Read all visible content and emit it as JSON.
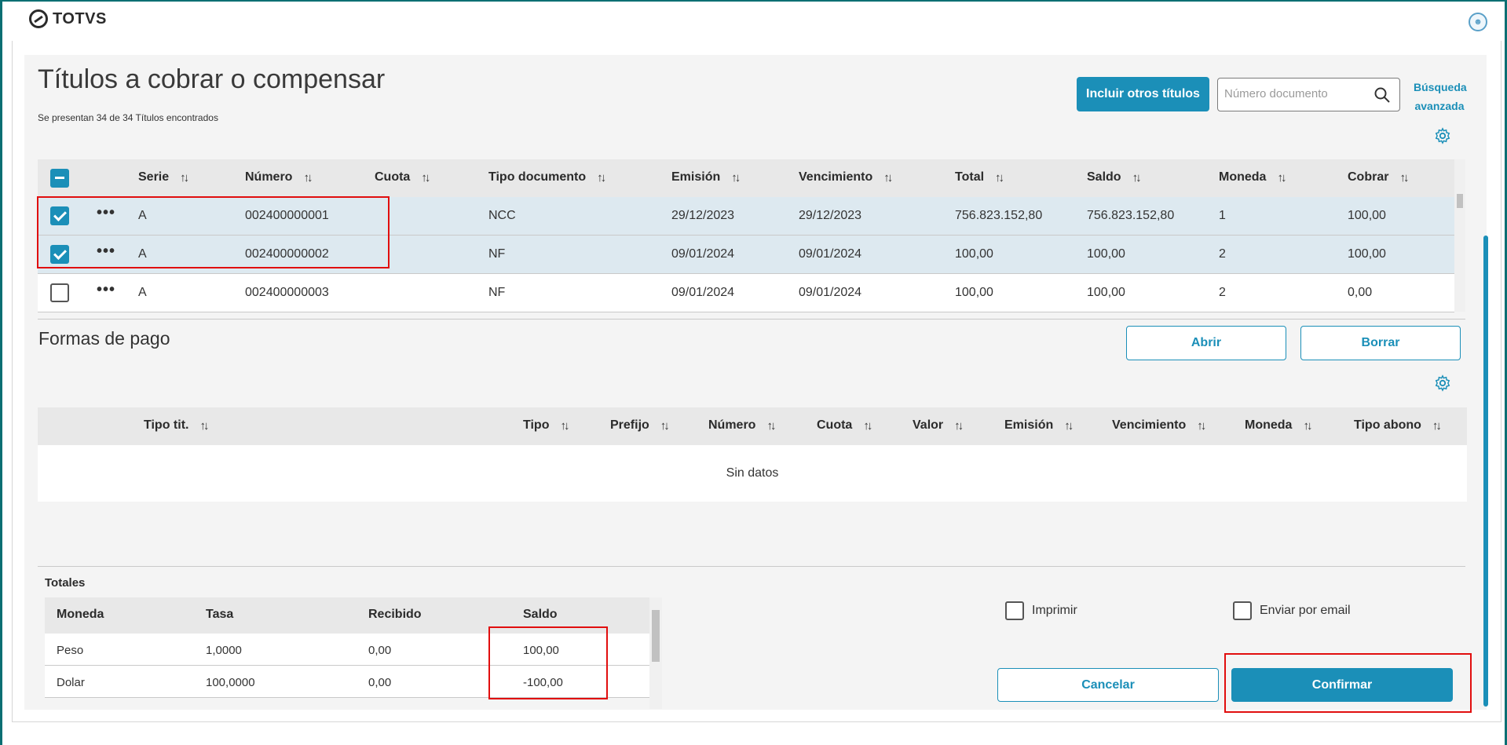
{
  "app": {
    "logo_text": "TOTVS"
  },
  "page": {
    "title": "Títulos a cobrar o compensar",
    "subtitle": "Se presentan 34 de 34 Títulos encontrados",
    "include_button": "Incluir otros títulos",
    "search_placeholder": "Número documento",
    "advanced_search": "Búsqueda avanzada"
  },
  "titles_table": {
    "columns": [
      "Serie",
      "Número",
      "Cuota",
      "Tipo documento",
      "Emisión",
      "Vencimiento",
      "Total",
      "Saldo",
      "Moneda",
      "Cobrar"
    ],
    "rows": [
      {
        "checked": true,
        "serie": "A",
        "numero": "002400000001",
        "cuota": "",
        "tipo": "NCC",
        "emision": "29/12/2023",
        "vencimiento": "29/12/2023",
        "total": "756.823.152,80",
        "saldo": "756.823.152,80",
        "moneda": "1",
        "cobrar": "100,00"
      },
      {
        "checked": true,
        "serie": "A",
        "numero": "002400000002",
        "cuota": "",
        "tipo": "NF",
        "emision": "09/01/2024",
        "vencimiento": "09/01/2024",
        "total": "100,00",
        "saldo": "100,00",
        "moneda": "2",
        "cobrar": "100,00"
      },
      {
        "checked": false,
        "serie": "A",
        "numero": "002400000003",
        "cuota": "",
        "tipo": "NF",
        "emision": "09/01/2024",
        "vencimiento": "09/01/2024",
        "total": "100,00",
        "saldo": "100,00",
        "moneda": "2",
        "cobrar": "0,00"
      }
    ]
  },
  "payment": {
    "title": "Formas de pago",
    "open_button": "Abrir",
    "delete_button": "Borrar",
    "columns": [
      "Tipo tit.",
      "Tipo",
      "Prefijo",
      "Número",
      "Cuota",
      "Valor",
      "Emisión",
      "Vencimiento",
      "Moneda",
      "Tipo abono"
    ],
    "empty_text": "Sin datos"
  },
  "totals": {
    "label": "Totales",
    "columns": [
      "Moneda",
      "Tasa",
      "Recibido",
      "Saldo"
    ],
    "rows": [
      {
        "moneda": "Peso",
        "tasa": "1,0000",
        "recibido": "0,00",
        "saldo": "100,00"
      },
      {
        "moneda": "Dolar",
        "tasa": "100,0000",
        "recibido": "0,00",
        "saldo": "-100,00"
      }
    ]
  },
  "options": {
    "print_label": "Imprimir",
    "email_label": "Enviar por email"
  },
  "actions": {
    "cancel": "Cancelar",
    "confirm": "Confirmar"
  },
  "colors": {
    "accent": "#1b8fb8",
    "selected_row": "#dde9f0",
    "highlight": "#e10e0e"
  }
}
